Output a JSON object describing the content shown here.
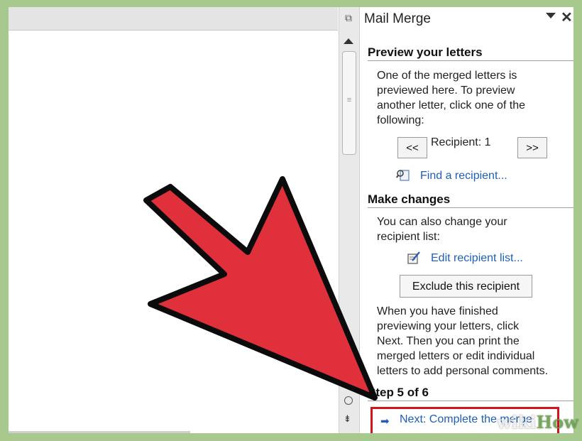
{
  "pane": {
    "title": "Mail Merge",
    "menu_icon": "chevron-down-icon",
    "close_icon": "close-icon"
  },
  "preview": {
    "heading": "Preview your letters",
    "text_lines": [
      "One of the merged letters is",
      "previewed here. To preview",
      "another letter, click one of the",
      "following:"
    ],
    "prev_label": "<<",
    "next_label": ">>",
    "recipient_label": "Recipient: 1",
    "find_label": "Find a recipient..."
  },
  "changes": {
    "heading": "Make changes",
    "text_lines": [
      "You can also change your",
      "recipient list:"
    ],
    "edit_label": "Edit recipient list...",
    "exclude_label": "Exclude this recipient",
    "finish_lines": [
      "When you have finished",
      "previewing your letters, click",
      "Next. Then you can print the",
      "merged letters or edit individual",
      "letters to add personal comments."
    ]
  },
  "step": {
    "label": "Step 5 of 6",
    "next_label": "Next: Complete the merge"
  },
  "watermark": {
    "text": "wiki",
    "text_b": "How"
  },
  "colors": {
    "link": "#1f5fb5",
    "highlight_box": "#d2141c",
    "arrow_fill": "#e0303c",
    "frame": "#a7c98e"
  }
}
